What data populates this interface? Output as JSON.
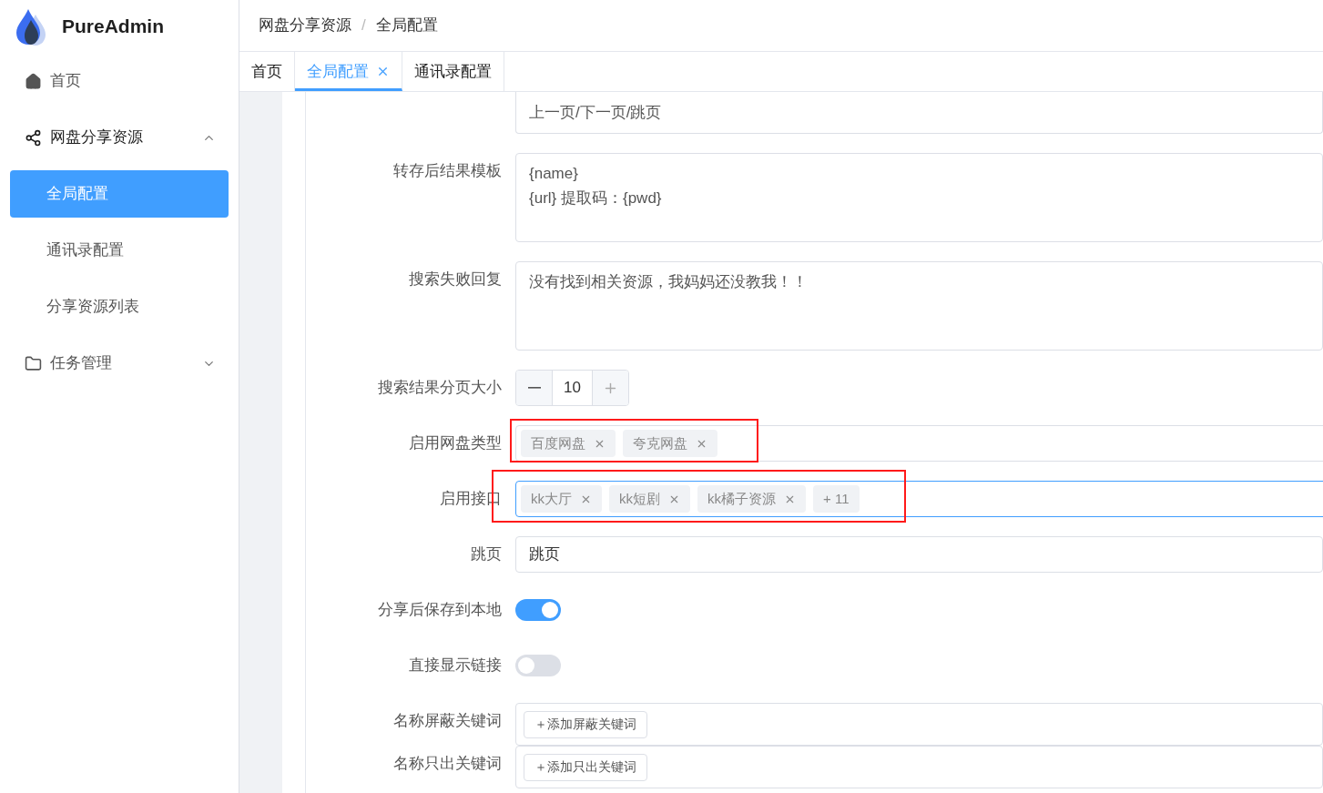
{
  "brand": {
    "name": "PureAdmin"
  },
  "sidebar": {
    "items": [
      {
        "label": "首页",
        "kind": "link",
        "selected": false
      },
      {
        "label": "网盘分享资源",
        "kind": "group",
        "expanded": true,
        "children": [
          {
            "label": "全局配置",
            "selected": true
          },
          {
            "label": "通讯录配置",
            "selected": false
          },
          {
            "label": "分享资源列表",
            "selected": false
          }
        ]
      },
      {
        "label": "任务管理",
        "kind": "group",
        "expanded": false
      }
    ]
  },
  "breadcrumb": {
    "items": [
      "网盘分享资源",
      "全局配置"
    ],
    "separator": "/"
  },
  "tabs": [
    {
      "label": "首页",
      "selected": false
    },
    {
      "label": "全局配置",
      "selected": true
    },
    {
      "label": "通讯录配置",
      "selected": false
    }
  ],
  "form": {
    "fields": [
      {
        "kind": "textarea",
        "lines": [
          "上一页/下一页/跳页"
        ]
      },
      {
        "kind": "textarea",
        "label": "转存后结果模板",
        "lines": [
          "{name}",
          "{url} 提取码：{pwd}"
        ]
      },
      {
        "kind": "textarea",
        "label": "搜索失败回复",
        "lines": [
          "没有找到相关资源，我妈妈还没教我！！"
        ]
      },
      {
        "kind": "number",
        "label": "搜索结果分页大小",
        "value": "10"
      },
      {
        "kind": "tags",
        "label": "启用网盘类型",
        "tags": [
          "百度网盘",
          "夸克网盘"
        ],
        "highlighted": true,
        "focused": false
      },
      {
        "kind": "tags",
        "label": "启用接口",
        "tags": [
          "kk大厅",
          "kk短剧",
          "kk橘子资源"
        ],
        "more": "+ 11",
        "highlighted": true,
        "focused": true
      },
      {
        "kind": "input",
        "label": "跳页",
        "value": "跳页"
      },
      {
        "kind": "switch",
        "label": "分享后保存到本地",
        "on": true
      },
      {
        "kind": "switch",
        "label": "直接显示链接",
        "on": false
      },
      {
        "kind": "keywords",
        "label": "名称屏蔽关键词",
        "button": "＋添加屏蔽关键词"
      },
      {
        "kind": "keywords",
        "label": "名称只出关键词",
        "button": "＋添加只出关键词"
      }
    ]
  }
}
